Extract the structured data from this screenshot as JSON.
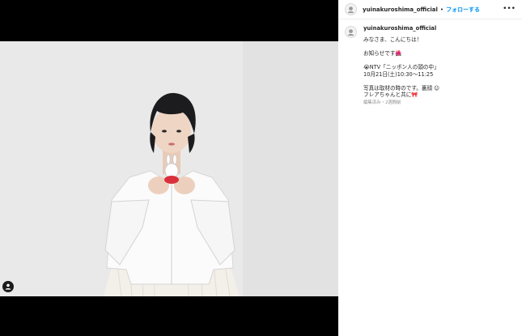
{
  "post": {
    "username": "yuinakuroshima_official",
    "separator": "•",
    "follow_label": "フォローする",
    "more_label": "•••"
  },
  "caption": {
    "username": "yuinakuroshima_official",
    "lines": [
      "みなさま、こんにちは！",
      "",
      "お知らせです🌺",
      "",
      "😭NTV「ニッポン人の頭の中」",
      "10月21日(土)10:30〜11:25",
      "",
      "写真は取材の時のです。裏顔 ☺",
      "フレアちゃんと共に🎀"
    ],
    "meta": "編集済み・2週間前"
  },
  "icons": {
    "avatar": "avatar-icon",
    "user_tag": "person-icon",
    "more": "more-options-icon"
  },
  "colors": {
    "accent": "#0095f6",
    "media_background": "#000000"
  }
}
